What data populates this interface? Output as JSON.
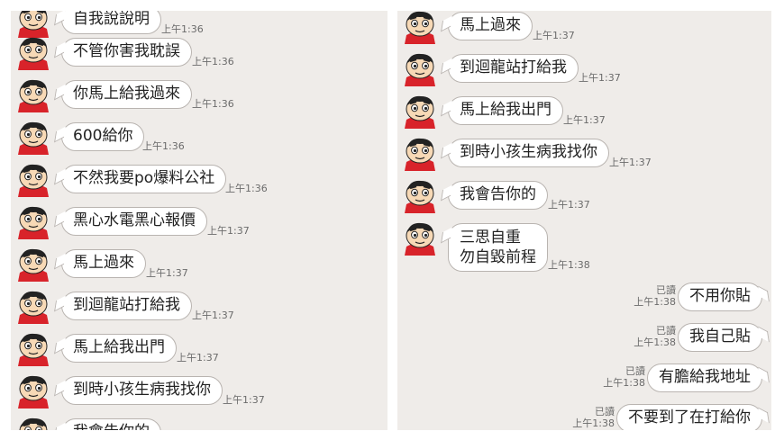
{
  "left_chat": {
    "messages": [
      {
        "text": "自我說說明",
        "time": "上午1:36"
      },
      {
        "text": "不管你害我耽誤",
        "time": "上午1:36"
      },
      {
        "text": "你馬上給我過來",
        "time": "上午1:36"
      },
      {
        "text": "600給你",
        "time": "上午1:36"
      },
      {
        "text": "不然我要po爆料公社",
        "time": "上午1:36"
      },
      {
        "text": "黑心水電黑心報價",
        "time": "上午1:37"
      },
      {
        "text": "馬上過來",
        "time": "上午1:37"
      },
      {
        "text": "到迴龍站打給我",
        "time": "上午1:37"
      },
      {
        "text": "馬上給我出門",
        "time": "上午1:37"
      },
      {
        "text": "到時小孩生病我找你",
        "time": "上午1:37"
      },
      {
        "text": "我會告你的",
        "time": ""
      }
    ]
  },
  "right_chat": {
    "incoming": [
      {
        "text": "馬上過來",
        "time": "上午1:37"
      },
      {
        "text": "到迴龍站打給我",
        "time": "上午1:37"
      },
      {
        "text": "馬上給我出門",
        "time": "上午1:37"
      },
      {
        "text": "到時小孩生病我找你",
        "time": "上午1:37"
      },
      {
        "text": "我會告你的",
        "time": "上午1:37"
      },
      {
        "text": "三思自重\n勿自毀前程",
        "time": "上午1:38"
      }
    ],
    "outgoing": [
      {
        "text": "不用你貼",
        "read": "已讀",
        "time": "上午1:38"
      },
      {
        "text": "我自己貼",
        "read": "已讀",
        "time": "上午1:38"
      },
      {
        "text": "有膽給我地址",
        "read": "已讀",
        "time": "上午1:38"
      },
      {
        "text": "不要到了在打給你",
        "read": "已讀",
        "time": "上午1:38"
      }
    ]
  },
  "colors": {
    "chat_bg": "#efece9",
    "bubble": "#ffffff",
    "bubble_border": "#b9b4b0"
  },
  "icons": {
    "avatar": "shinchan-avatar-icon"
  }
}
